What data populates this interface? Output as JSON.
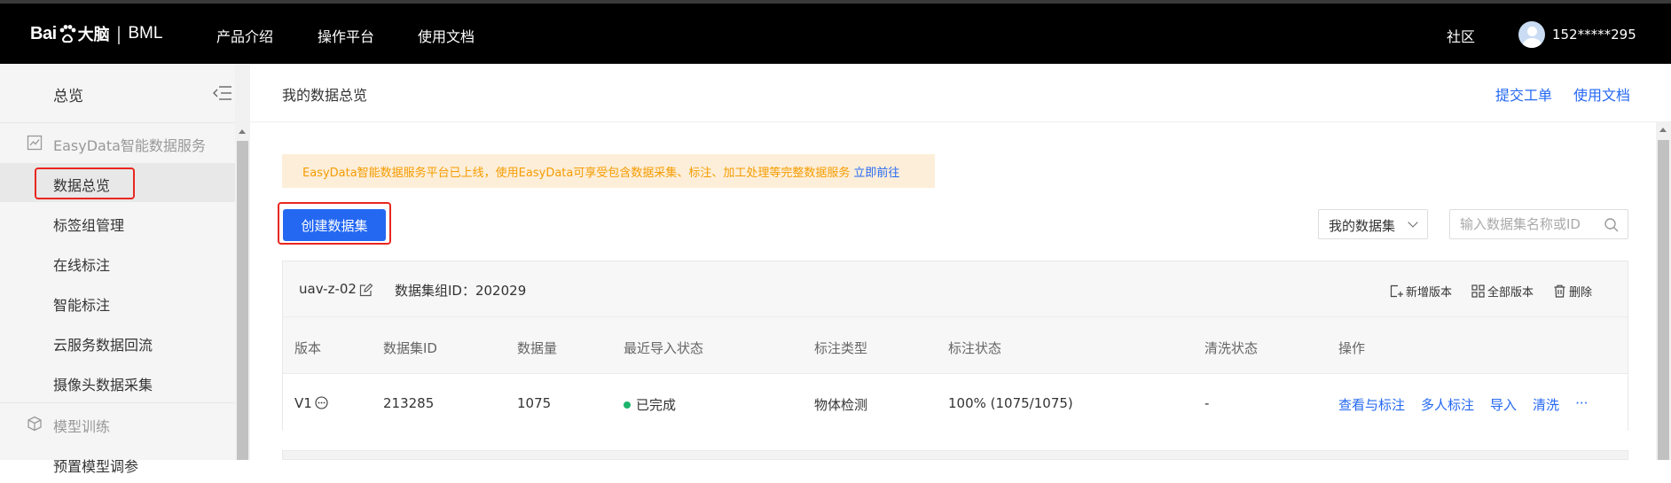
{
  "header": {
    "logo_brand": "Bai",
    "logo_cn": "大脑",
    "logo_sep": "|",
    "logo_product": "BML",
    "nav": [
      "产品介绍",
      "操作平台",
      "使用文档"
    ],
    "community": "社区",
    "user": "152*****295"
  },
  "sidebar": {
    "title": "总览",
    "groups": [
      {
        "label": "EasyData智能数据服务",
        "icon": "chart-icon",
        "items": [
          "数据总览",
          "标签组管理",
          "在线标注",
          "智能标注",
          "云服务数据回流",
          "摄像头数据采集"
        ]
      },
      {
        "label": "模型训练",
        "icon": "cube-icon",
        "items": [
          "预置模型调参"
        ]
      }
    ],
    "active_item": "数据总览"
  },
  "main": {
    "breadcrumb": "我的数据总览",
    "links": [
      "提交工单",
      "使用文档"
    ],
    "notice": {
      "text": "EasyData智能数据服务平台已上线，使用EasyData可享受包含数据采集、标注、加工处理等完整数据服务",
      "link": "立即前往"
    },
    "create_button": "创建数据集",
    "filter_select": "我的数据集",
    "search_placeholder": "输入数据集名称或ID",
    "dataset_group": {
      "name": "uav-z-02",
      "group_id_label": "数据集组ID：202029",
      "actions": [
        "新增版本",
        "全部版本",
        "删除"
      ],
      "columns": [
        "版本",
        "数据集ID",
        "数据量",
        "最近导入状态",
        "标注类型",
        "标注状态",
        "清洗状态",
        "操作"
      ],
      "rows": [
        {
          "version": "V1",
          "dataset_id": "213285",
          "count": "1075",
          "import_status": "已完成",
          "label_type": "物体检测",
          "label_status": "100% (1075/1075)",
          "clean_status": "-",
          "ops": [
            "查看与标注",
            "多人标注",
            "导入",
            "清洗",
            "···"
          ]
        }
      ]
    }
  },
  "colors": {
    "accent": "#2468f2",
    "topbar": "#000000",
    "notice_bg": "#fdeed9",
    "notice_text": "#f59c00",
    "success": "#1db36d",
    "highlight": "#e8261f"
  }
}
